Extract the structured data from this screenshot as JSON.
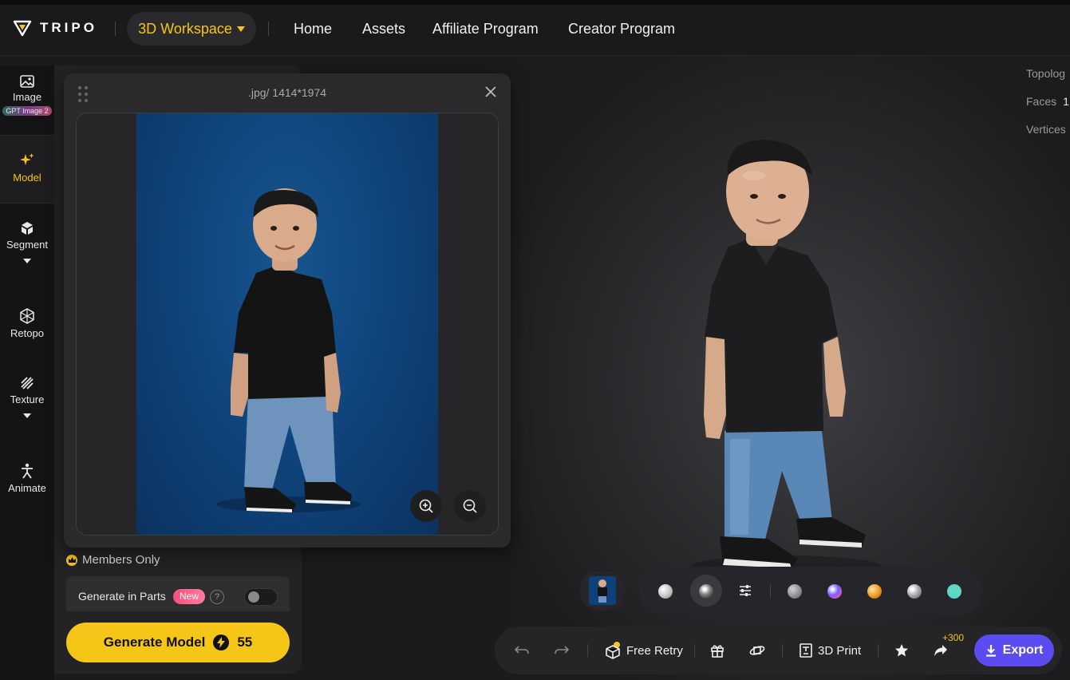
{
  "header": {
    "brand": "TRIPO",
    "workspace_label": "3D Workspace",
    "nav": [
      "Home",
      "Assets",
      "Affiliate Program",
      "Creator Program"
    ]
  },
  "rail": {
    "items": [
      {
        "label": "Image",
        "badge": "GPT Image 2",
        "icon": "image-icon"
      },
      {
        "label": "Model",
        "icon": "sparkle-icon",
        "active": true
      },
      {
        "label": "Segment",
        "icon": "cube-icon"
      },
      {
        "label": "Retopo",
        "icon": "mesh-icon"
      },
      {
        "label": "Texture",
        "icon": "texture-icon"
      },
      {
        "label": "Animate",
        "icon": "figure-icon"
      }
    ]
  },
  "popup": {
    "title": ".jpg/ 1414*1974"
  },
  "panel": {
    "members_label": "Members Only",
    "generate_parts_label": "Generate in Parts",
    "new_badge": "New",
    "help": "?",
    "generate_label": "Generate Model",
    "generate_cost": "55"
  },
  "stats": {
    "topology_label": "Topolog",
    "faces_label": "Faces",
    "faces_value": "1",
    "vertices_label": "Vertices"
  },
  "materials": {
    "colors": [
      "#e0e0e0",
      "#bdbdbd",
      "#9a9a9d",
      "#7b5cff",
      "#f0a030",
      "#b0b0b0",
      "#5fd6c8"
    ]
  },
  "actions": {
    "free_retry_label": "Free Retry",
    "print_label": "3D Print",
    "bonus": "+300",
    "export_label": "Export"
  },
  "colors": {
    "accent_yellow": "#f5c518",
    "export_purple": "#5b4bf0"
  }
}
